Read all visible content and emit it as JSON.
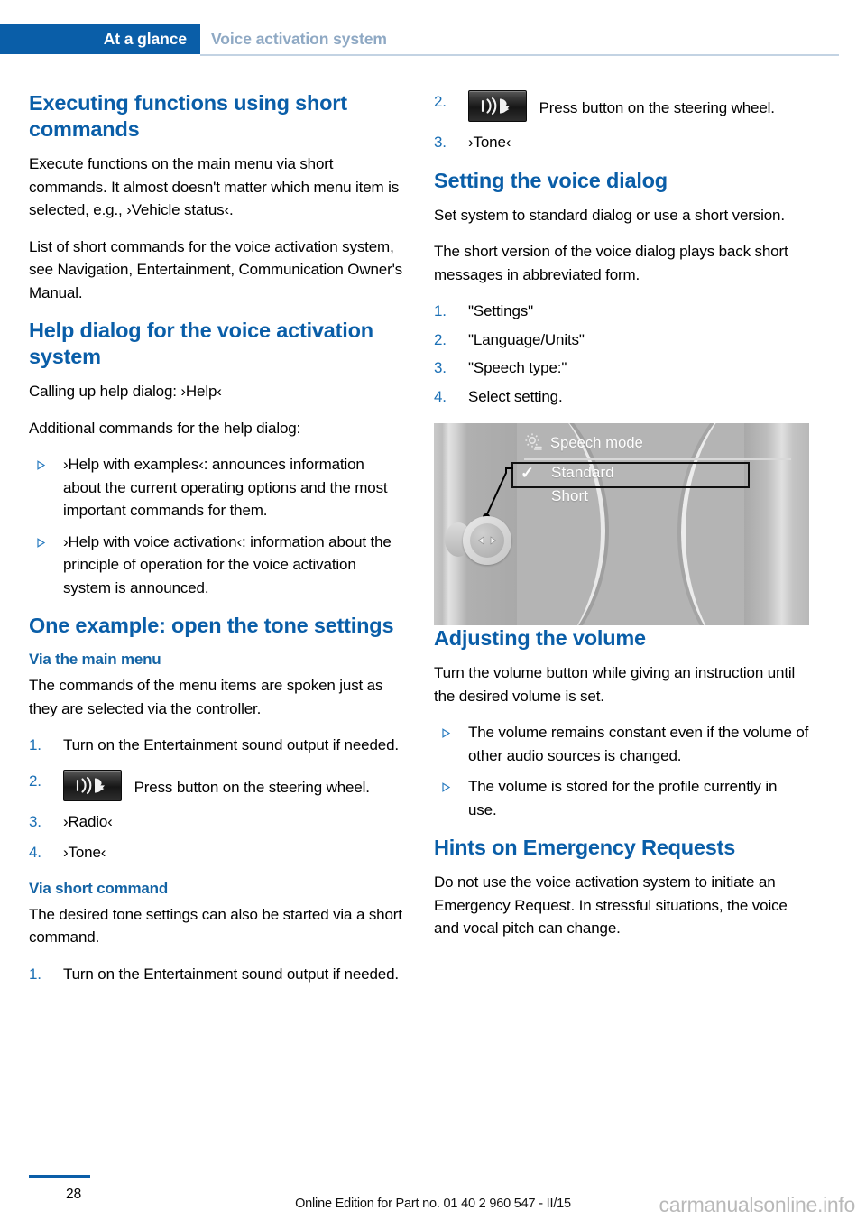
{
  "header": {
    "tab_label": "At a glance",
    "section_label": "Voice activation system"
  },
  "left_column": {
    "h_short_commands": "Executing functions using short commands",
    "p_short_commands_1": "Execute functions on the main menu via short commands. It almost doesn't matter which menu item is selected, e.g., ›Vehicle status‹.",
    "p_short_commands_2": "List of short commands for the voice activation system, see Navigation, Entertainment, Communication Owner's Manual.",
    "h_help_dialog": "Help dialog for the voice activation system",
    "p_help_1": "Calling up help dialog: ›Help‹",
    "p_help_2": "Additional commands for the help dialog:",
    "help_bullets": [
      "›Help with examples‹: announces information about the current operating options and the most important commands for them.",
      "›Help with voice activation‹: information about the principle of operation for the voice activation system is announced."
    ],
    "h_one_example": "One example: open the tone settings",
    "h_via_main_menu": "Via the main menu",
    "p_via_main_menu": "The commands of the menu items are spoken just as they are selected via the controller.",
    "main_menu_steps": [
      {
        "num": "1.",
        "text": "Turn on the Entertainment sound output if needed.",
        "icon": null
      },
      {
        "num": "2.",
        "text": "Press button on the steering wheel.",
        "icon": "voice-button-icon"
      },
      {
        "num": "3.",
        "text": "›Radio‹",
        "icon": null
      },
      {
        "num": "4.",
        "text": "›Tone‹",
        "icon": null
      }
    ],
    "h_via_short_command": "Via short command",
    "p_via_short_command": "The desired tone settings can also be started via a short command.",
    "short_command_steps": [
      {
        "num": "1.",
        "text": "Turn on the Entertainment sound output if needed.",
        "icon": null
      }
    ]
  },
  "right_column": {
    "continued_steps": [
      {
        "num": "2.",
        "text": "Press button on the steering wheel.",
        "icon": "voice-button-icon"
      },
      {
        "num": "3.",
        "text": "›Tone‹",
        "icon": null
      }
    ],
    "h_setting_voice_dialog": "Setting the voice dialog",
    "p_setting_1": "Set system to standard dialog or use a short version.",
    "p_setting_2": "The short version of the voice dialog plays back short messages in abbreviated form.",
    "setting_steps": [
      {
        "num": "1.",
        "text": "\"Settings\""
      },
      {
        "num": "2.",
        "text": "\"Language/Units\""
      },
      {
        "num": "3.",
        "text": "\"Speech type:\""
      },
      {
        "num": "4.",
        "text": "Select setting."
      }
    ],
    "idrive": {
      "icon": "gear-icon",
      "title": "Speech mode",
      "options": [
        {
          "label": "Standard",
          "checked": true,
          "selected": true
        },
        {
          "label": "Short",
          "checked": false,
          "selected": false
        }
      ],
      "check_glyph": "✓"
    },
    "h_adjusting_volume": "Adjusting the volume",
    "p_adjusting_volume": "Turn the volume button while giving an instruction until the desired volume is set.",
    "volume_bullets": [
      "The volume remains constant even if the volume of other audio sources is changed.",
      "The volume is stored for the profile currently in use."
    ],
    "h_hints_emergency": "Hints on Emergency Requests",
    "p_hints_emergency": "Do not use the voice activation system to initiate an Emergency Request. In stressful situations, the voice and vocal pitch can change."
  },
  "footer": {
    "page_number": "28",
    "edition": "Online Edition for Part no. 01 40 2 960 547 - II/15",
    "watermark": "carmanualsonline.info"
  },
  "colors": {
    "brand_blue": "#0a5ea8",
    "heading_blue": "#1464a5",
    "muted_blue": "#8fa9c4",
    "marker_blue": "#1a6fb5"
  }
}
